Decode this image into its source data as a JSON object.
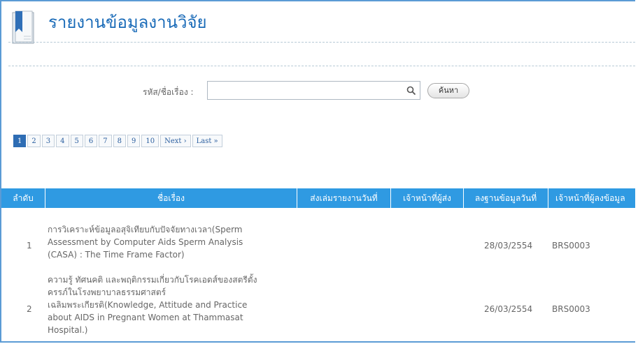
{
  "page": {
    "title": "รายงานข้อมูลงานวิจัย"
  },
  "search": {
    "label": "รหัส/ชื่อเรื่อง :",
    "value": "",
    "button_label": "ค้นหา"
  },
  "pagination": {
    "pages": [
      "1",
      "2",
      "3",
      "4",
      "5",
      "6",
      "7",
      "8",
      "9",
      "10"
    ],
    "active": "1",
    "next_label": "Next ›",
    "last_label": "Last »"
  },
  "table": {
    "columns": [
      "ลำดับ",
      "ชื่อเรื่อง",
      "ส่งเล่มรายงานวันที่",
      "เจ้าหน้าที่ผู้ส่ง",
      "ลงฐานข้อมูลวันที่",
      "เจ้าหน้าที่ผู้ลงข้อมูล"
    ],
    "rows": [
      {
        "no": "1",
        "title_lines": [
          "การวิเคราะห์ข้อมูลอสุจิเทียบกับปัจจัยทางเวลา(Sperm",
          "Assessment by Computer Aids Sperm Analysis",
          "(CASA) : The Time Frame Factor)"
        ],
        "submit_date": "",
        "submitter": "",
        "db_date": "28/03/2554",
        "db_staff": "BRS0003"
      },
      {
        "no": "2",
        "title_lines": [
          "ความรู้ ทัศนคติ และพฤติกรรมเกี่ยวกับโรคเอดส์ของสตรีตั้ง",
          "ครรภ์ในโรงพยาบาลธรรมศาสตร์",
          "เฉลิมพระเกียรติ(Knowledge, Attitude and Practice",
          "about AIDS in Pregnant Women at Thammasat",
          "Hospital.)"
        ],
        "submit_date": "",
        "submitter": "",
        "db_date": "26/03/2554",
        "db_staff": "BRS0003"
      }
    ]
  },
  "colors": {
    "header_bg": "#2f9ae2",
    "title": "#1a6bb8",
    "frame": "#5b9bd5",
    "active_page": "#2e6db4"
  }
}
